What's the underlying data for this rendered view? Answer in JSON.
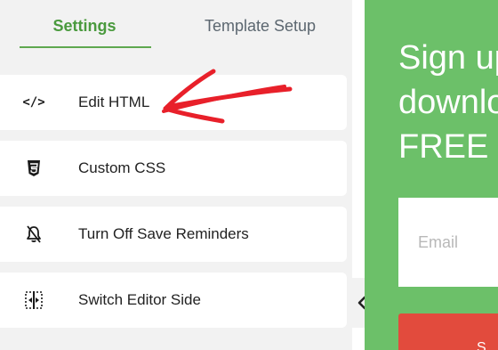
{
  "tabs": [
    {
      "label": "Settings",
      "active": true
    },
    {
      "label": "Template Setup",
      "active": false
    }
  ],
  "menu": [
    {
      "label": "Edit HTML",
      "icon": "code-icon"
    },
    {
      "label": "Custom CSS",
      "icon": "css3-icon"
    },
    {
      "label": "Turn Off Save Reminders",
      "icon": "bell-off-icon"
    },
    {
      "label": "Switch Editor Side",
      "icon": "switch-side-icon"
    }
  ],
  "preview": {
    "headline": "Sign up\ndownlo\nFREE E",
    "email_placeholder": "Email",
    "button_label": "S"
  },
  "colors": {
    "accent_green": "#4a9a3e",
    "preview_bg": "#6cc069",
    "button_red": "#e24b3d",
    "annotation_red": "#e8202a"
  }
}
